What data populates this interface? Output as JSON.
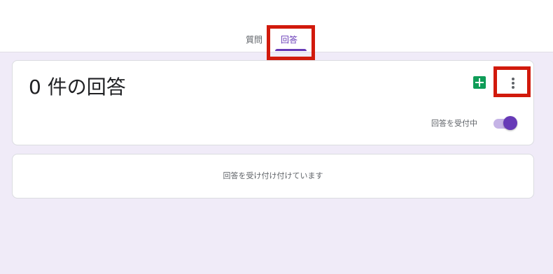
{
  "tabs": {
    "questions_label": "質問",
    "responses_label": "回答",
    "active": "responses"
  },
  "summary": {
    "title": "0 件の回答",
    "accepting_label": "回答を受付中",
    "accepting_on": true,
    "sheets_icon": "google-sheets-icon",
    "menu_icon": "more-vert-icon"
  },
  "status": {
    "message": "回答を受け付け付けています"
  },
  "colors": {
    "accent": "#673ab7",
    "background": "#f0ebf8",
    "sheets": "#0f9d58",
    "highlight": "#d11a0c"
  }
}
